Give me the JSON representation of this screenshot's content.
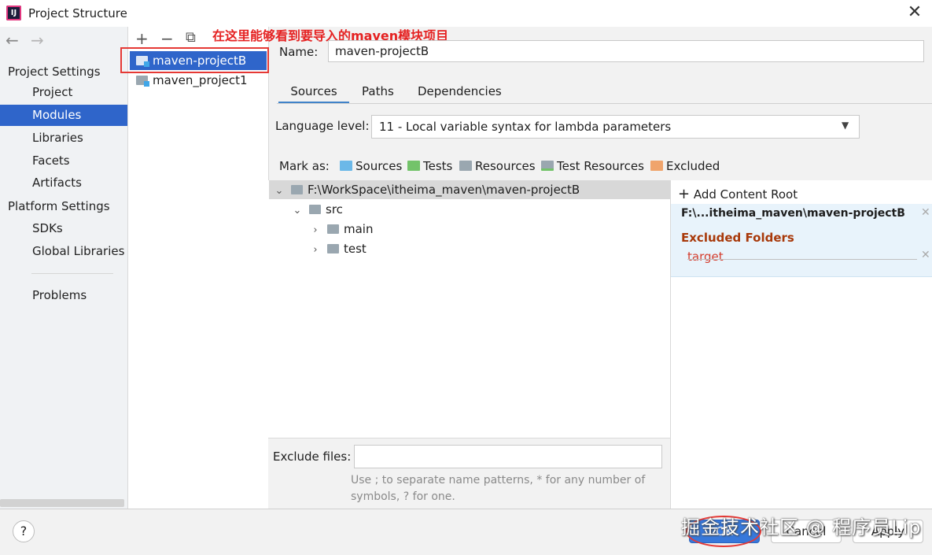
{
  "window": {
    "title": "Project Structure",
    "close": "✕"
  },
  "annotation": "在这里能够看到要导入的maven模块项目",
  "nav": {
    "back": "←",
    "forward": "→",
    "project_settings": "Project Settings",
    "items_ps": [
      "Project",
      "Modules",
      "Libraries",
      "Facets",
      "Artifacts"
    ],
    "platform_settings": "Platform Settings",
    "items_platform": [
      "SDKs",
      "Global Libraries"
    ],
    "problems": "Problems",
    "selected": "Modules"
  },
  "modules": {
    "toolbar": {
      "add": "+",
      "remove": "−",
      "copy": "⧉"
    },
    "items": [
      "maven-projectB",
      "maven_project1"
    ],
    "selected": "maven-projectB"
  },
  "module": {
    "name_label": "Name:",
    "name_value": "maven-projectB",
    "tabs": [
      "Sources",
      "Paths",
      "Dependencies"
    ],
    "active_tab": "Sources",
    "language_level_label": "Language level:",
    "language_level_value": "11 - Local variable syntax for lambda parameters",
    "mark_as_label": "Mark as:",
    "mark_as": [
      {
        "label": "Sources",
        "color": "#6bb8e8"
      },
      {
        "label": "Tests",
        "color": "#73c36a"
      },
      {
        "label": "Resources",
        "color": "#9aa7b0"
      },
      {
        "label": "Test Resources",
        "color": "#9aa7b0"
      },
      {
        "label": "Excluded",
        "color": "#f0a46c"
      }
    ],
    "tree": {
      "root": "F:\\WorkSpace\\itheima_maven\\maven-projectB",
      "children": [
        {
          "name": "src",
          "expanded": true,
          "children": [
            "main",
            "test"
          ]
        }
      ]
    },
    "exclude_files_label": "Exclude files:",
    "exclude_files_value": "",
    "exclude_hint": "Use ; to separate name patterns, * for any number of symbols, ? for one."
  },
  "content_root": {
    "add_label": "Add Content Root",
    "path": "F:\\...itheima_maven\\maven-projectB",
    "excluded_folders_label": "Excluded Folders",
    "excluded": [
      "target"
    ]
  },
  "buttons": {
    "help": "?",
    "ok": "OK",
    "cancel": "Cancel",
    "apply": "Apply"
  },
  "watermark": "掘金技术社区 @ 程序员Lip"
}
